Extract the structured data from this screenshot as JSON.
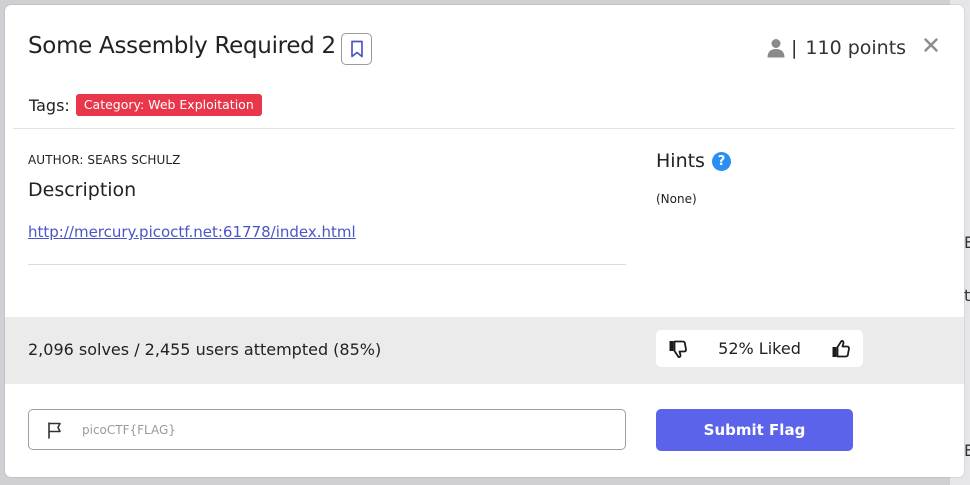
{
  "challenge": {
    "title": "Some Assembly Required 2",
    "points_separator": "|",
    "points": "110 points",
    "tags_label": "Tags:",
    "tags": [
      "Category: Web Exploitation"
    ],
    "author": "AUTHOR: SEARS SCHULZ",
    "description_heading": "Description",
    "link": "http://mercury.picoctf.net:61778/index.html",
    "hints_heading": "Hints",
    "hints_value": "(None)",
    "help_glyph": "?"
  },
  "stats": {
    "solves_text": "2,096 solves / 2,455 users attempted (85%)",
    "liked_text": "52% Liked"
  },
  "flag_form": {
    "placeholder": "picoCTF{FLAG}",
    "submit_label": "Submit Flag"
  },
  "backdrop": {
    "edge_glyphs": [
      "E",
      "t",
      "E"
    ]
  },
  "icons": {
    "bookmark": "bookmark-icon",
    "user": "user-icon",
    "close": "close-icon",
    "help": "question-circle-icon",
    "dislike": "thumbs-down-icon",
    "like": "thumbs-up-icon",
    "flag": "flag-icon"
  },
  "colors": {
    "accent": "#5b63ea",
    "badge": "#e8374b",
    "link": "#4a56c8",
    "help": "#2b8ef2",
    "stats_bar": "#ebebeb"
  }
}
